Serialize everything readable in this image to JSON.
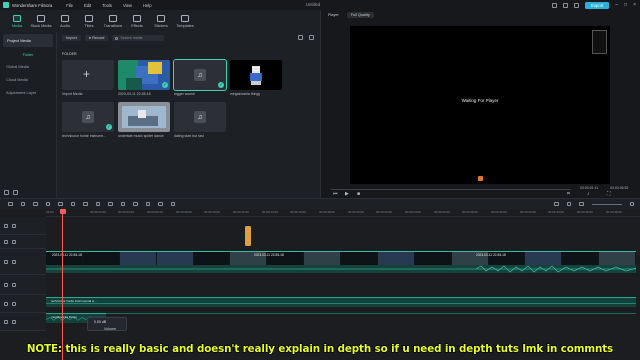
{
  "app": {
    "name": "Wondershare Filmora",
    "menu": [
      "File",
      "Edit",
      "Tools",
      "View",
      "Help"
    ],
    "doc_title": "Untitled",
    "export_label": "Export"
  },
  "toolbar": {
    "tools": [
      {
        "label": "Media",
        "icon": "media-icon",
        "active": true
      },
      {
        "label": "Stock Media",
        "icon": "stock-media-icon"
      },
      {
        "label": "Audio",
        "icon": "audio-icon"
      },
      {
        "label": "Titles",
        "icon": "titles-icon"
      },
      {
        "label": "Transitions",
        "icon": "transitions-icon"
      },
      {
        "label": "Effects",
        "icon": "effects-icon"
      },
      {
        "label": "Stickers",
        "icon": "stickers-icon"
      },
      {
        "label": "Templates",
        "icon": "templates-icon"
      }
    ]
  },
  "sidebar": {
    "project_media": "Project Media",
    "folder": "Folder",
    "items": [
      "Global Media",
      "Cloud Media",
      "Adjustment Layer"
    ]
  },
  "media": {
    "import_label": "Import",
    "record_label": "Record",
    "search_placeholder": "Search media",
    "folder_label": "FOLDER",
    "items": [
      {
        "caption": "Import Media"
      },
      {
        "caption": "2023-03-11 22-55-18"
      },
      {
        "caption": "bigger woosh"
      },
      {
        "caption": "megalovania thingy"
      },
      {
        "caption": "technicolor horde instrume..."
      },
      {
        "caption": "undertale music spider dance"
      },
      {
        "caption": "dating start but fast"
      }
    ]
  },
  "player": {
    "tab_label": "Player",
    "quality": "Full Quality",
    "waiting_text": "Waiting For Player",
    "time_current": "00:00:01:11",
    "time_total": "00:00:06:52"
  },
  "timeline": {
    "ruler_ticks": [
      "01:00",
      "00:00:02:00",
      "00:00:04:00",
      "00:00:06:00",
      "00:00:08:00",
      "00:00:10:00",
      "00:00:12:00",
      "00:00:14:00",
      "00:00:16:00",
      "00:00:18:00",
      "00:00:20:00",
      "00:00:22:00",
      "00:00:24:00",
      "00:00:26:00",
      "00:00:28:00",
      "00:00:30:00",
      "00:00:32:00",
      "00:00:34:00",
      "00:00:36:00",
      "00:00:38:00",
      "00:00:40:00"
    ],
    "video_clip_label": "2023-03-11 22-55-18",
    "audio_track_1": "technicolor horde instrumental w...",
    "audio_track_2": "megalovania thingy",
    "volume_value": "0.00 dB",
    "volume_label": "Volume"
  },
  "overlay_note": "NOTE: this is really basic and doesn't really explain in depth so if u need in depth tuts lmk in commnts",
  "colors": {
    "accent": "#3fd0b8",
    "export": "#2ab0d6",
    "playhead": "#ff5c5c",
    "note_text": "#e8ff2a"
  }
}
